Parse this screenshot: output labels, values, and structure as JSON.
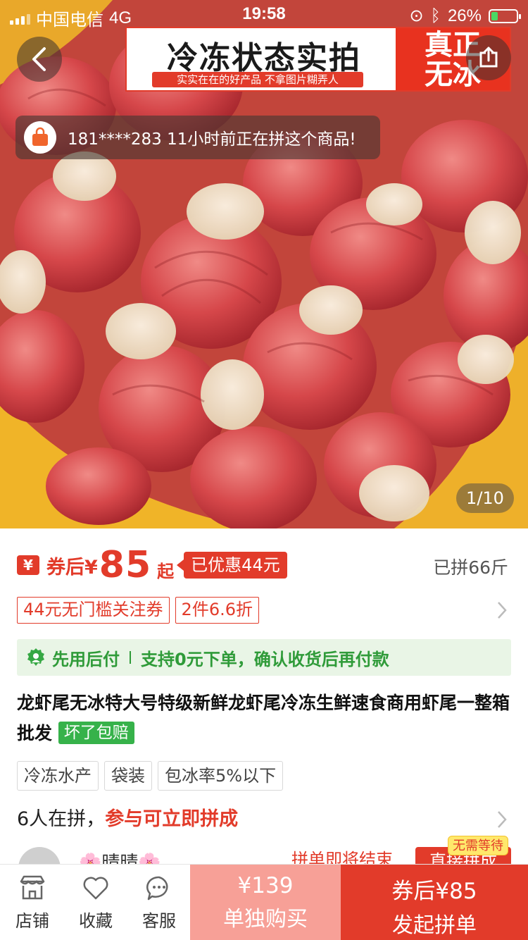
{
  "status_bar": {
    "carrier": "中国电信",
    "network": "4G",
    "time": "19:58",
    "battery": "26%",
    "battery_level": 0.26
  },
  "image": {
    "banner_title": "冷冻状态实拍",
    "banner_subtitle": "实实在在的好产品 不拿图片糊弄人",
    "banner_red_text_1": "真正",
    "banner_red_text_2": "无冰",
    "toast_text": "181****283 11小时前正在拼这个商品!",
    "pager": "1/10"
  },
  "price": {
    "currency_icon": "¥",
    "prefix": "券后¥",
    "value": "85",
    "suffix": "起",
    "discount": "已优惠44元",
    "sold": "已拼66斤"
  },
  "coupons": [
    "44元无门槛关注券",
    "2件6.6折"
  ],
  "pay_after": {
    "title": "先用后付",
    "description": "支持0元下单，确认收货后再付款"
  },
  "product": {
    "title": "龙虾尾无冰特大号特级新鲜龙虾尾冷冻生鲜速食商用虾尾一整箱批发",
    "badge": "坏了包赔"
  },
  "tags": [
    "冷冻水产",
    "袋装",
    "包冰率5%以下"
  ],
  "group": {
    "count_text": "6人在拼，",
    "join_text": "参与可立即拼成",
    "next_name": "🌸晴晴🌸",
    "next_end": "拼单即将结束",
    "next_button": "直接拼成",
    "no_wait": "无需等待"
  },
  "bottom_bar": {
    "shop": "店铺",
    "favorite": "收藏",
    "service": "客服",
    "alone_price": "¥139",
    "alone_label": "单独购买",
    "group_price": "券后¥85",
    "group_label": "发起拼单"
  },
  "colors": {
    "accent": "#e23b2a",
    "green": "#2f9b39",
    "pay_after_bg": "#e9f5e6"
  }
}
